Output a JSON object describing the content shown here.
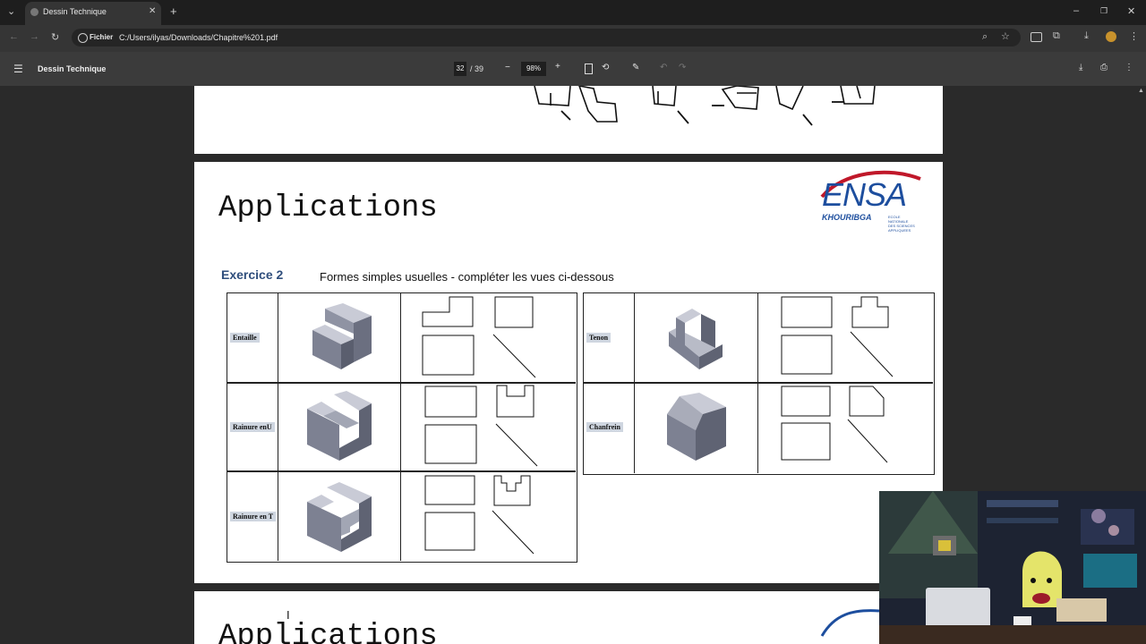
{
  "browser": {
    "tab_title": "Dessin Technique",
    "new_tab": "+",
    "site_chip": "Fichier",
    "url": "C:/Users/ilyas/Downloads/Chapitre%201.pdf",
    "window_controls": {
      "minimize": "–",
      "restore": "❐",
      "close": "✕"
    }
  },
  "pdf_toolbar": {
    "menu_icon": "☰",
    "title": "Dessin Technique",
    "current_page": "32",
    "total_pages": "/ 39",
    "zoom": "98%",
    "zoom_out": "−",
    "zoom_in": "+"
  },
  "slide": {
    "title": "Applications",
    "exercise_label": "Exercice 2",
    "exercise_text": "Formes simples usuelles - compléter les vues ci-dessous",
    "logo_main": "ENSA",
    "logo_city": "KHOURIBGA",
    "logo_sub": [
      "ECOLE",
      "NATIONALE",
      "DES SCIENCES",
      "APPLIQUEES"
    ],
    "left_table": [
      {
        "label": "Entaille"
      },
      {
        "label": "Rainure enU"
      },
      {
        "label": "Rainure en T"
      }
    ],
    "right_table": [
      {
        "label": "Tenon"
      },
      {
        "label": "Chanfrein"
      }
    ]
  },
  "next_slide": {
    "title": "Applications"
  },
  "colors": {
    "accent_blue": "#2f4e7c",
    "logo_red": "#c0182a",
    "logo_blue": "#1d4e9e",
    "label_bg": "#cfd6e0"
  }
}
